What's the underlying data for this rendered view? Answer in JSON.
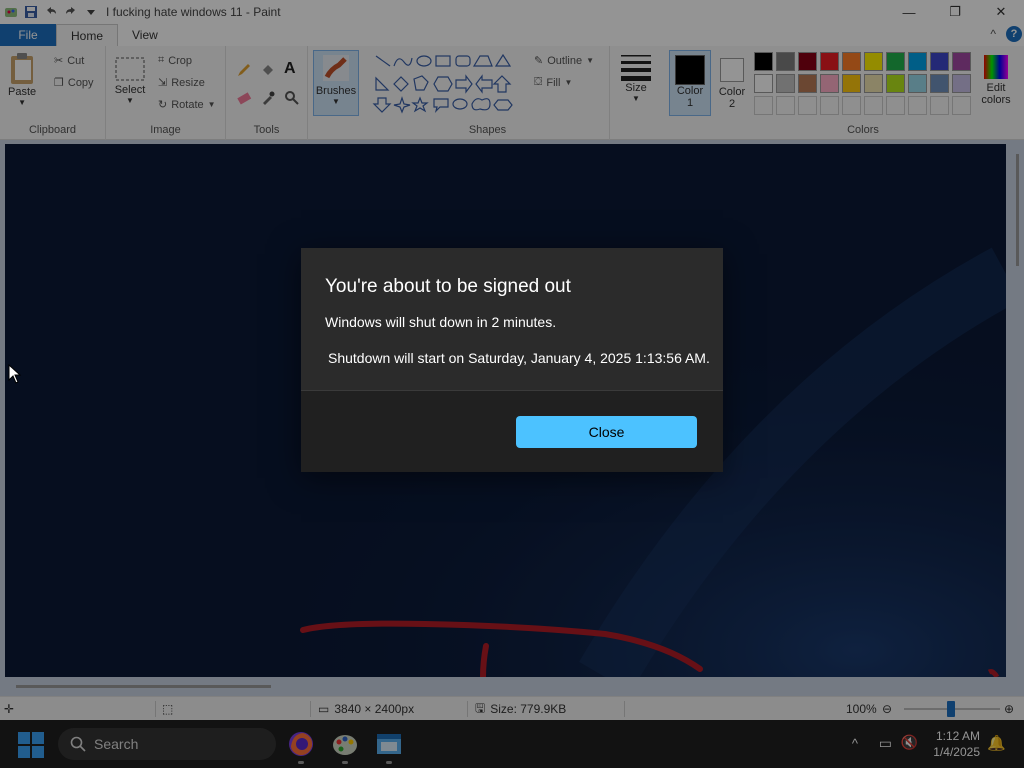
{
  "window": {
    "title": "I fucking hate windows 11 - Paint",
    "minimize_glyph": "—",
    "maximize_glyph": "❐",
    "close_glyph": "✕"
  },
  "ribbon_tabs": [
    {
      "label": "File"
    },
    {
      "label": "Home"
    },
    {
      "label": "View"
    }
  ],
  "ribbon": {
    "clipboard": {
      "paste": "Paste",
      "cut": "Cut",
      "copy": "Copy",
      "group": "Clipboard"
    },
    "image": {
      "select": "Select",
      "crop": "Crop",
      "resize": "Resize",
      "rotate": "Rotate",
      "group": "Image"
    },
    "tools": {
      "group": "Tools"
    },
    "brushes": {
      "label": "Brushes"
    },
    "shapes": {
      "outline": "Outline",
      "fill": "Fill",
      "group": "Shapes"
    },
    "size": {
      "label": "Size"
    },
    "color1": {
      "label_line1": "Color",
      "label_line2": "1"
    },
    "color2": {
      "label_line1": "Color",
      "label_line2": "2"
    },
    "colors": {
      "group": "Colors",
      "edit_line1": "Edit",
      "edit_line2": "colors"
    },
    "palette_row1": [
      "#000000",
      "#7f7f7f",
      "#880015",
      "#ed1c24",
      "#ff7f27",
      "#fff200",
      "#22b14c",
      "#00a2e8",
      "#3f48cc",
      "#a349a4"
    ],
    "palette_row2": [
      "#ffffff",
      "#c3c3c3",
      "#b97a57",
      "#ffaec9",
      "#ffc90e",
      "#efe4b0",
      "#b5e61d",
      "#99d9ea",
      "#7092be",
      "#c8bfe7"
    ]
  },
  "statusbar": {
    "dimensions": "3840 × 2400px",
    "size": "Size: 779.9KB",
    "zoom": "100%"
  },
  "dialog": {
    "title": "You're about to be signed out",
    "message": "Windows will shut down in 2 minutes.",
    "detail": "Shutdown will start on Saturday, January 4, 2025 1:13:56 AM.",
    "close_label": "Close"
  },
  "taskbar": {
    "search_placeholder": "Search",
    "time": "1:12 AM",
    "date": "1/4/2025"
  },
  "colors": {
    "accent": "#4cc2ff",
    "file_tab": "#1d6fbf",
    "canvas_bg": "#0b1936",
    "stroke": "#b11d27"
  }
}
